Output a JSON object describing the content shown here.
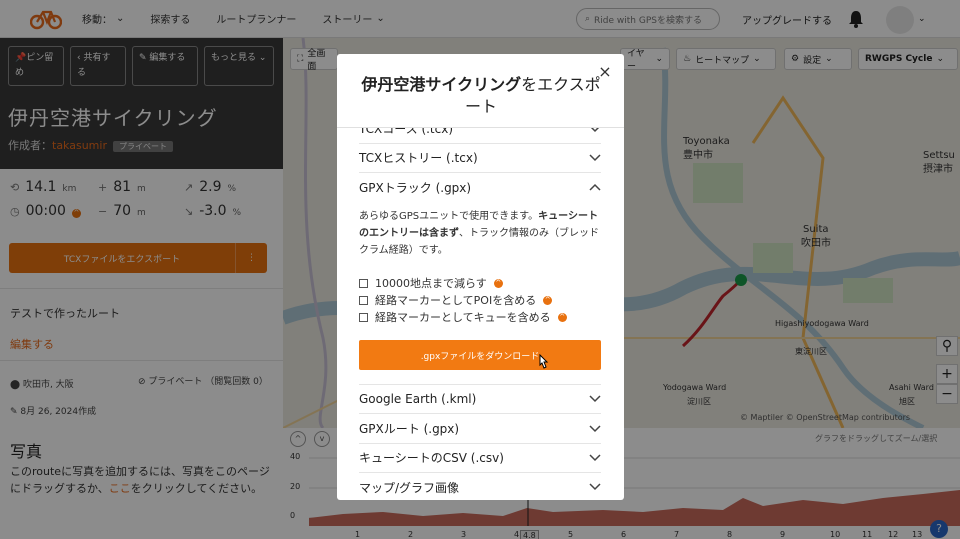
{
  "nav": {
    "items": [
      "移動：",
      "探索する",
      "ルートプランナー",
      "ストーリー"
    ],
    "search_placeholder": "Ride with GPSを検索する",
    "upgrade": "アップグレードする",
    "icons": [
      "bicycle-logo-icon",
      "search-icon",
      "bell-icon",
      "avatar"
    ]
  },
  "sidebar": {
    "actions": [
      "ピン留め",
      "共有する",
      "編集する",
      "もっと見る"
    ],
    "title": "伊丹空港サイクリング",
    "author_prefix": "作成者：",
    "author": "takasumir",
    "visibility_badge": "プライベート",
    "stats": {
      "distance": "14.1",
      "distance_unit": "km",
      "elevation_gain": "81",
      "elevation_gain_unit": "m",
      "grade_up": "2.9",
      "grade_up_unit": "%",
      "time": "00:00",
      "elevation_loss": "70",
      "elevation_loss_unit": "m",
      "grade_down": "-3.0",
      "grade_down_unit": "%"
    },
    "export_button": "TCXファイルをエクスポート",
    "export_more": "⋮",
    "description": "テストで作ったルート",
    "edit_link": "編集する",
    "location": "吹田市, 大阪",
    "privacy": "プライベート （閲覧回数 0）",
    "created": "8月 26, 2024作成",
    "photos_heading": "写真",
    "photos_text_1": "このrouteに写真を追加するには、写真をこのページにドラッグするか、",
    "photos_link": "ここ",
    "photos_text_2": "をクリックしてください。"
  },
  "map": {
    "toolbar": {
      "fullscreen": "全画面",
      "layers_partial": "イヤー",
      "heatmap": "ヒートマップ",
      "settings": "設定",
      "basemap": "RWGPS Cycle"
    },
    "labels": [
      "Toyonaka",
      "豊中市",
      "Settsu",
      "摂津市",
      "Suita",
      "吹田市",
      "Higashiyodogawa Ward",
      "東淀川区",
      "Yodogawa Ward",
      "淀川区",
      "Asahi Ward",
      "旭区"
    ],
    "attribution": "© Maptiler © OpenStreetMap contributors",
    "colors": {
      "route": "#c0262c",
      "water": "#aec9d6",
      "park": "#cfe3c3"
    }
  },
  "graph": {
    "hint": "グラフをドラッグしてズーム/選択",
    "y_ticks": [
      "40",
      "20",
      "0"
    ],
    "x_ticks": [
      "1",
      "2",
      "3",
      "4",
      "4.8",
      "5",
      "6",
      "7",
      "8",
      "9",
      "10",
      "11",
      "12",
      "13"
    ],
    "zoom_buttons": [
      "^",
      "v"
    ],
    "y_unit_partial": "m 高"
  },
  "modal": {
    "title_bold": "伊丹空港サイクリング",
    "title_rest": "をエクスポート",
    "close": "×",
    "formats": [
      "TCXコース (.tcx)",
      "TCXヒストリー (.tcx)",
      "GPXトラック (.gpx)",
      "Google Earth (.kml)",
      "GPXルート (.gpx)",
      "キューシートのCSV (.csv)",
      "マップ/グラフ画像"
    ],
    "gpx_desc_1": "あらゆるGPSユニットで使用できます。",
    "gpx_desc_bold": "キューシートのエントリーは含まず",
    "gpx_desc_2": "、トラック情報のみ（ブレッドクラム経路）です。",
    "options": [
      {
        "label": "10000地点まで減らす",
        "checked": false
      },
      {
        "label": "経路マーカーとしてPOIを含める",
        "checked": false
      },
      {
        "label": "経路マーカーとしてキューを含める",
        "checked": false
      }
    ],
    "download_button": ".gpxファイルをダウンロード",
    "accent": "#f27a12"
  }
}
